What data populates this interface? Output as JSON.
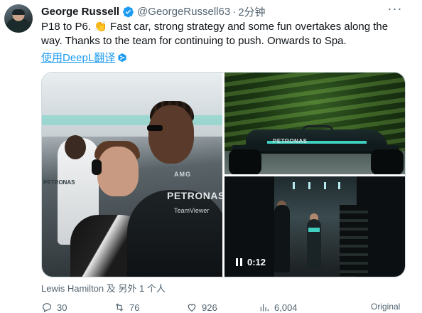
{
  "tweet": {
    "author_name": "George Russell",
    "handle": "@GeorgeRussell63",
    "separator": "·",
    "time": "2分钟",
    "more_label": "···",
    "text": "P18 to P6. 👏 Fast car, strong strategy and some fun overtakes along the way. Thanks to the team for continuing to push. Onwards to Spa.",
    "translate_label": "使用DeepL翻译",
    "verified_color": "#1d9bf0",
    "link_color": "#1d9bf0"
  },
  "media": {
    "photo1": {
      "petronas": "PETRONAS",
      "amg": "AMG",
      "teamviewer": "TeamViewer",
      "petronas_small": "PETRONAS"
    },
    "photo2": {
      "car_text": "PETRONAS"
    },
    "video": {
      "duration": "0:12",
      "state": "playing"
    }
  },
  "tagged": "Lewis Hamilton 及 另外 1 个人",
  "actions": {
    "replies": "30",
    "reposts": "76",
    "likes": "926",
    "views": "6,004",
    "translate": "Original"
  }
}
